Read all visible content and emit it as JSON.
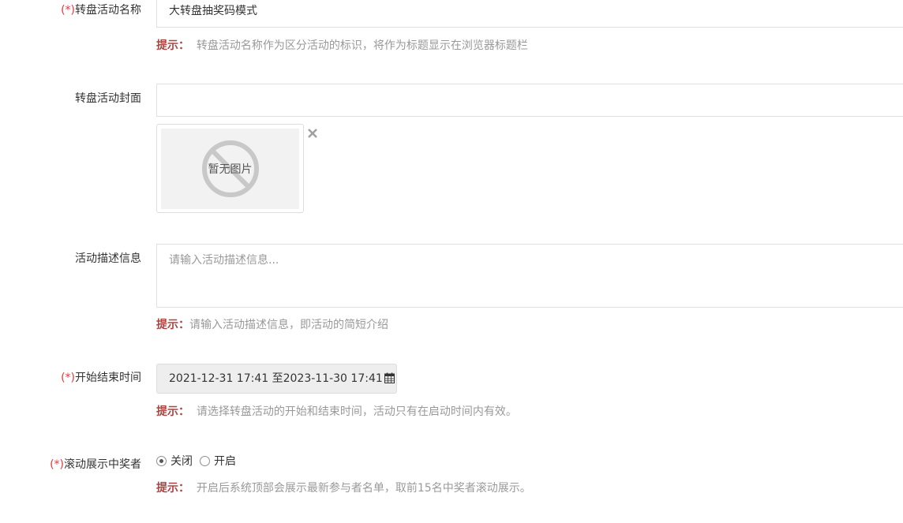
{
  "required_mark": "(*)",
  "hint_label": "提示：",
  "name_field": {
    "label": "转盘活动名称",
    "value": "大转盘抽奖码模式",
    "hint": "转盘活动名称作为区分活动的标识，将作为标题显示在浏览器标题栏"
  },
  "cover_field": {
    "label": "转盘活动封面",
    "value": "",
    "placeholder_image_text": "暂无图片"
  },
  "description_field": {
    "label": "活动描述信息",
    "placeholder": "请输入活动描述信息...",
    "hint": "请输入活动描述信息，即活动的简短介绍"
  },
  "time_field": {
    "label": "开始结束时间",
    "value": "2021-12-31 17:41 至2023-11-30 17:41",
    "hint": "请选择转盘活动的开始和结束时间，活动只有在启动时间内有效。"
  },
  "scroll_winners_field": {
    "label": "滚动展示中奖者",
    "options": [
      "关闭",
      "开启"
    ],
    "selected": "关闭",
    "hint": "开启后系统顶部会展示最新参与者名单，取前15名中奖者滚动展示。"
  },
  "colors": {
    "required": "#e4393c",
    "hint_label": "#a94442",
    "hint_text": "#999999",
    "border": "#e1e1e1",
    "disabled_bg": "#eeeeee"
  },
  "icons": {
    "remove": "close-icon",
    "no_image": "no-image-icon",
    "calendar": "calendar-icon"
  }
}
